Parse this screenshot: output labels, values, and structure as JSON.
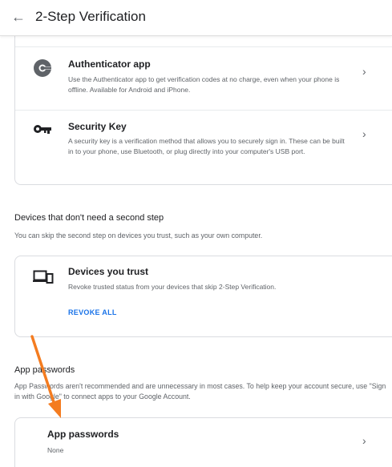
{
  "header": {
    "back_icon": "arrow-left-icon",
    "title": "2-Step Verification"
  },
  "methods": [
    {
      "icon": "authenticator-icon",
      "title": "Authenticator app",
      "description": "Use the Authenticator app to get verification codes at no charge, even when your phone is offline. Available for Android and iPhone."
    },
    {
      "icon": "key-icon",
      "title": "Security Key",
      "description": "A security key is a verification method that allows you to securely sign in. These can be built in to your phone, use Bluetooth, or plug directly into your computer's USB port."
    }
  ],
  "devices_section": {
    "title": "Devices that don't need a second step",
    "description": "You can skip the second step on devices you trust, such as your own computer.",
    "card": {
      "icon": "devices-icon",
      "title": "Devices you trust",
      "description": "Revoke trusted status from your devices that skip 2-Step Verification.",
      "action": "REVOKE ALL"
    }
  },
  "app_passwords_section": {
    "title": "App passwords",
    "description": "App Passwords aren't recommended and are unnecessary in most cases. To help keep your account secure, use \"Sign in with Google\" to connect apps to your Google Account.",
    "card": {
      "title": "App passwords",
      "value": "None"
    }
  },
  "annotation": {
    "color": "#f47c20"
  },
  "colors": {
    "link": "#1a73e8",
    "icon": "#5f6368",
    "text": "#202124",
    "secondary_text": "#5f6368",
    "border": "#dadce0"
  }
}
